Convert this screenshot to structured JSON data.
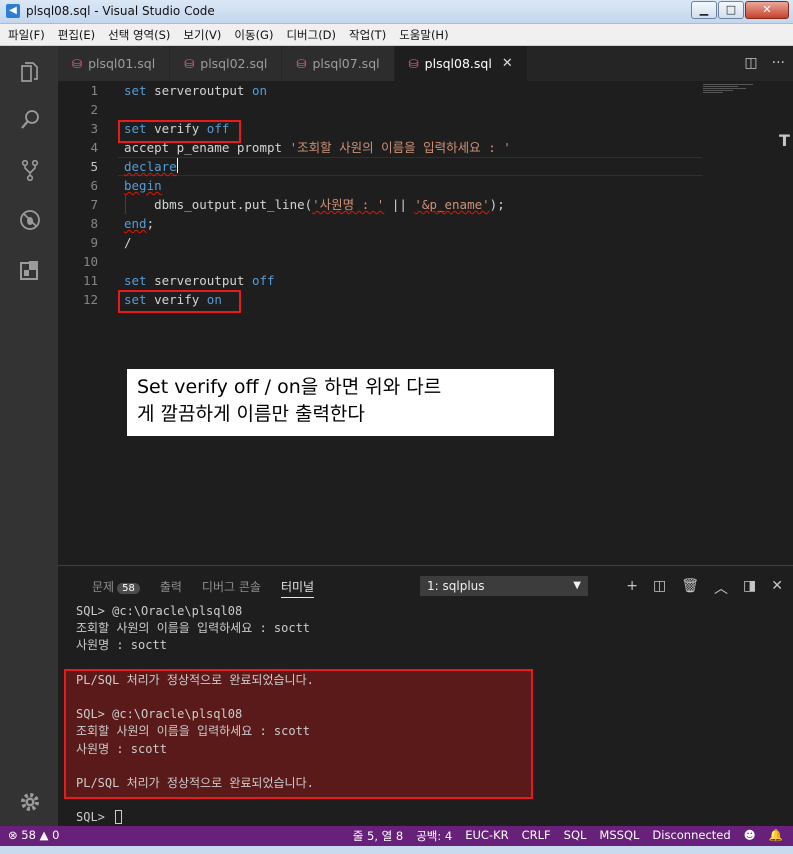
{
  "window": {
    "title": "plsql08.sql - Visual Studio Code",
    "min": "▁",
    "max": "□",
    "close": "✕"
  },
  "menu": [
    "파일(F)",
    "편집(E)",
    "선택 영역(S)",
    "보기(V)",
    "이동(G)",
    "디버그(D)",
    "작업(T)",
    "도움말(H)"
  ],
  "activity_icons": [
    "explorer-icon",
    "search-icon",
    "source-control-icon",
    "debug-icon",
    "extensions-icon",
    "settings-gear-icon"
  ],
  "tabs": [
    {
      "label": "plsql01.sql",
      "active": false
    },
    {
      "label": "plsql02.sql",
      "active": false
    },
    {
      "label": "plsql07.sql",
      "active": false
    },
    {
      "label": "plsql08.sql",
      "active": true
    }
  ],
  "editor": {
    "lines": [
      {
        "n": "1",
        "parts": [
          [
            "kw",
            "set"
          ],
          [
            "t",
            " serveroutput "
          ],
          [
            "kw",
            "on"
          ]
        ]
      },
      {
        "n": "2",
        "parts": []
      },
      {
        "n": "3",
        "parts": [
          [
            "kw",
            "set"
          ],
          [
            "t",
            " verify "
          ],
          [
            "kw",
            "off"
          ]
        ]
      },
      {
        "n": "4",
        "parts": [
          [
            "t",
            "accept p_ename prompt "
          ],
          [
            "str",
            "'조회할 사원의 이름을 입력하세요 : '"
          ]
        ]
      },
      {
        "n": "5",
        "parts": [
          [
            "kw",
            "declare"
          ]
        ]
      },
      {
        "n": "6",
        "parts": [
          [
            "kw",
            "begin"
          ]
        ]
      },
      {
        "n": "7",
        "parts": [
          [
            "t",
            "    dbms_output.put_line("
          ],
          [
            "str",
            "'사원명 : '"
          ],
          [
            "t",
            " || "
          ],
          [
            "str",
            "'&p_ename'"
          ],
          [
            "t",
            ");"
          ]
        ]
      },
      {
        "n": "8",
        "parts": [
          [
            "kw",
            "end"
          ],
          [
            "t",
            ";"
          ]
        ]
      },
      {
        "n": "9",
        "parts": [
          [
            "t",
            "/"
          ]
        ]
      },
      {
        "n": "10",
        "parts": []
      },
      {
        "n": "11",
        "parts": [
          [
            "kw",
            "set"
          ],
          [
            "t",
            " serveroutput "
          ],
          [
            "kw",
            "off"
          ]
        ]
      },
      {
        "n": "12",
        "parts": [
          [
            "kw",
            "set"
          ],
          [
            "t",
            " verify "
          ],
          [
            "kw",
            "on"
          ]
        ]
      }
    ],
    "scroll_marker": "T"
  },
  "annotation": {
    "line1": "Set verify off / on을 하면 위와 다르",
    "line2": "게 깔끔하게 이름만 출력한다"
  },
  "panel": {
    "tabs": [
      {
        "label": "문제",
        "badge": "58"
      },
      {
        "label": "출력"
      },
      {
        "label": "디버그 콘솔"
      },
      {
        "label": "터미널",
        "active": true
      }
    ],
    "terminal_select": "1: sqlplus",
    "terminal_lines": [
      "SQL> @c:\\Oracle\\plsql08",
      "조회할 사원의 이름을 입력하세요 : soctt",
      "사원명 : soctt",
      "",
      "PL/SQL 처리가 정상적으로 완료되었습니다.",
      "",
      "SQL> @c:\\Oracle\\plsql08",
      "조회할 사원의 이름을 입력하세요 : scott",
      "사원명 : scott",
      "",
      "PL/SQL 처리가 정상적으로 완료되었습니다.",
      "",
      "SQL> "
    ]
  },
  "status": {
    "errors": "58",
    "warnings": "0",
    "position": "줄 5, 열 8",
    "spaces": "공백: 4",
    "encoding": "EUC-KR",
    "eol": "CRLF",
    "language": "SQL",
    "dialect": "MSSQL",
    "connection": "Disconnected"
  }
}
